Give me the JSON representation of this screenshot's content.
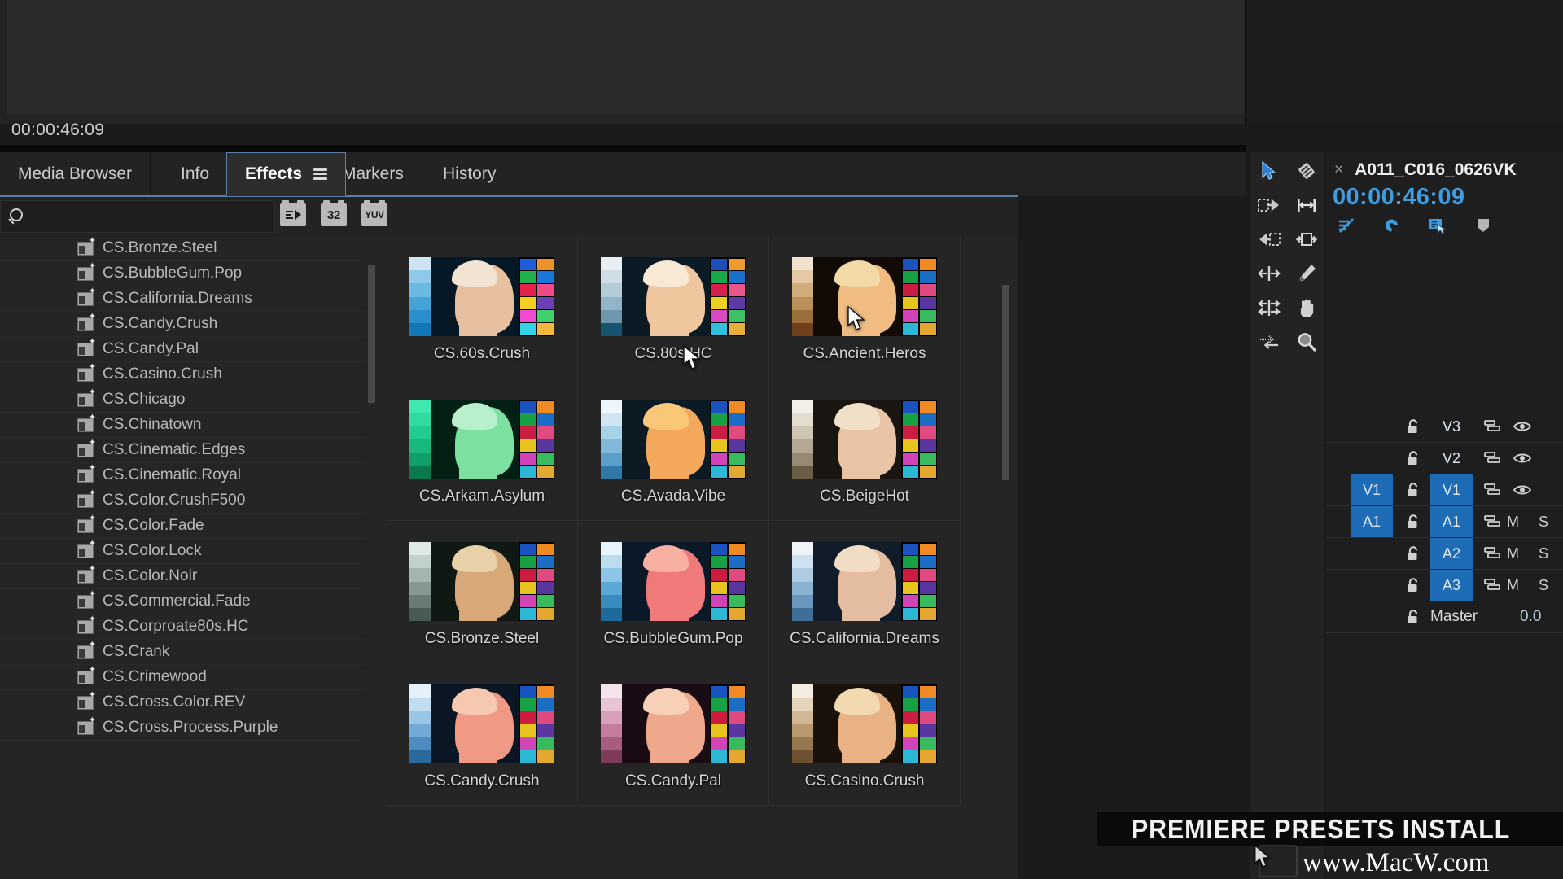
{
  "monitor": {
    "timecode": "00:00:46:09"
  },
  "tabs": [
    {
      "label": "Media Browser",
      "active": false,
      "menu": false
    },
    {
      "label": "Info",
      "active": false,
      "menu": false
    },
    {
      "label": "Effects",
      "active": true,
      "menu": true
    },
    {
      "label": "Markers",
      "active": false,
      "menu": false
    },
    {
      "label": "History",
      "active": false,
      "menu": false
    }
  ],
  "search": {
    "value": "",
    "placeholder": "",
    "icon": "search-icon",
    "badges": [
      {
        "name": "accelerated-effects-badge",
        "label": ""
      },
      {
        "name": "32-bit-color-badge",
        "label": "32"
      },
      {
        "name": "yuv-effects-badge",
        "label": "YUV"
      }
    ]
  },
  "effects_list": {
    "items": [
      "CS.Bronze.Steel",
      "CS.BubbleGum.Pop",
      "CS.California.Dreams",
      "CS.Candy.Crush",
      "CS.Candy.Pal",
      "CS.Casino.Crush",
      "CS.Chicago",
      "CS.Chinatown",
      "CS.Cinematic.Edges",
      "CS.Cinematic.Royal",
      "CS.Color.CrushF500",
      "CS.Color.Fade",
      "CS.Color.Lock",
      "CS.Color.Noir",
      "CS.Commercial.Fade",
      "CS.Corproate80s.HC",
      "CS.Crank",
      "CS.Crimewood",
      "CS.Cross.Color.REV",
      "CS.Cross.Process.Purple"
    ]
  },
  "grid": {
    "cells": [
      {
        "label": "CS.60s.Crush",
        "ramp": [
          "#cfe4f2",
          "#8ec9ea",
          "#6ab9e3",
          "#46a3d8",
          "#2a8fcc",
          "#1277b8"
        ],
        "bg": "#061726",
        "skin": "#e8c0a0",
        "hair": "#f2e4d2",
        "chips": [
          "#1d5fd8",
          "#f0922c",
          "#21b24c",
          "#1877d8",
          "#e8204a",
          "#ef4b86",
          "#f5d020",
          "#6b3fb5",
          "#f04bd0",
          "#3fd06a",
          "#34d4e8",
          "#f2b73c"
        ]
      },
      {
        "label": "CS.80s.HC",
        "ramp": [
          "#e8eef2",
          "#cfdde6",
          "#b4cbd8",
          "#93b4c6",
          "#6f98ae",
          "#14546f"
        ],
        "bg": "#0a1b26",
        "skin": "#f0c69e",
        "hair": "#f7e9d4",
        "chips": [
          "#1d4fb8",
          "#f09c2c",
          "#18a84a",
          "#1a72c8",
          "#d4204a",
          "#e8548c",
          "#ecd022",
          "#5e3aa8",
          "#d84bc0",
          "#3cc266",
          "#2fc0dc",
          "#e8b038"
        ]
      },
      {
        "label": "CS.Ancient.Heros",
        "ramp": [
          "#f2e3cf",
          "#e4c9a4",
          "#d2ad7c",
          "#bb8f58",
          "#9b6f3c",
          "#703f1c"
        ],
        "bg": "#120a04",
        "skin": "#f0bc82",
        "hair": "#f4d9a8",
        "chips": [
          "#1a52c0",
          "#f08a22",
          "#17a044",
          "#1a6fc4",
          "#cc1c42",
          "#e04a80",
          "#e8c41e",
          "#5a36a0",
          "#d044b8",
          "#38ba5e",
          "#2cb8d4",
          "#e4a830"
        ]
      },
      {
        "label": "CS.Arkam.Asylum",
        "ramp": [
          "#3fe8b0",
          "#2edba0",
          "#22cc90",
          "#19b97e",
          "#12a06a",
          "#0a7a4e"
        ],
        "bg": "#042014",
        "skin": "#7ce0a0",
        "hair": "#b8f0cc",
        "chips": [
          "#1a52c0",
          "#f08a22",
          "#17a044",
          "#1a6fc4",
          "#cc1c42",
          "#e04a80",
          "#e8c41e",
          "#5a36a0",
          "#d044b8",
          "#38ba5e",
          "#2cb8d4",
          "#e4a830"
        ]
      },
      {
        "label": "CS.Avada.Vibe",
        "ramp": [
          "#eef6fb",
          "#cfe6f2",
          "#a8d2e8",
          "#7fbadb",
          "#5a9fca",
          "#2f78a8"
        ],
        "bg": "#0c1a24",
        "skin": "#f4a85c",
        "hair": "#f8c878",
        "chips": [
          "#1a52c0",
          "#f08a22",
          "#17a044",
          "#1a6fc4",
          "#cc1c42",
          "#e04a80",
          "#e8c41e",
          "#5a36a0",
          "#d044b8",
          "#38ba5e",
          "#2cb8d4",
          "#e4a830"
        ]
      },
      {
        "label": "CS.BeigeHot",
        "ramp": [
          "#f4f0e8",
          "#e4ddd0",
          "#cfc5b4",
          "#b4a894",
          "#978a74",
          "#6a5d48"
        ],
        "bg": "#1a1510",
        "skin": "#e8c4a4",
        "hair": "#f0e0c8",
        "chips": [
          "#1a52c0",
          "#f08a22",
          "#17a044",
          "#1a6fc4",
          "#cc1c42",
          "#e04a80",
          "#e8c41e",
          "#5a36a0",
          "#d044b8",
          "#38ba5e",
          "#2cb8d4",
          "#e4a830"
        ]
      },
      {
        "label": "CS.Bronze.Steel",
        "ramp": [
          "#dfe8e4",
          "#c2d0cc",
          "#a4b4b0",
          "#879894",
          "#6a7a76",
          "#4a5a56"
        ],
        "bg": "#101814",
        "skin": "#d8a878",
        "hair": "#e8d0a8",
        "chips": [
          "#1a52c0",
          "#f08a22",
          "#17a044",
          "#1a6fc4",
          "#cc1c42",
          "#e04a80",
          "#e8c41e",
          "#5a36a0",
          "#d044b8",
          "#38ba5e",
          "#2cb8d4",
          "#e4a830"
        ]
      },
      {
        "label": "CS.BubbleGum.Pop",
        "ramp": [
          "#e8f4fb",
          "#bcdcf0",
          "#8cc4e4",
          "#5aa8d4",
          "#3a8cbf",
          "#1f6a9c"
        ],
        "bg": "#0a1828",
        "skin": "#f07a7a",
        "hair": "#f8b0a0",
        "chips": [
          "#1a52c0",
          "#f08a22",
          "#17a044",
          "#1a6fc4",
          "#cc1c42",
          "#e04a80",
          "#e8c41e",
          "#5a36a0",
          "#d044b8",
          "#38ba5e",
          "#2cb8d4",
          "#e4a830"
        ]
      },
      {
        "label": "CS.California.Dreams",
        "ramp": [
          "#eef4fa",
          "#cfe0ee",
          "#aecbe2",
          "#8cb2d2",
          "#6a96bc",
          "#3f6e96"
        ],
        "bg": "#101c2a",
        "skin": "#e4bca0",
        "hair": "#f0ddc4",
        "chips": [
          "#1a52c0",
          "#f08a22",
          "#17a044",
          "#1a6fc4",
          "#cc1c42",
          "#e04a80",
          "#e8c41e",
          "#5a36a0",
          "#d044b8",
          "#38ba5e",
          "#2cb8d4",
          "#e4a830"
        ]
      },
      {
        "label": "CS.Candy.Crush",
        "ramp": [
          "#e4f0fa",
          "#c0ddf0",
          "#9ac6e6",
          "#72aad6",
          "#4d8cc0",
          "#2a6a9c"
        ],
        "bg": "#0a1624",
        "skin": "#f09a86",
        "hair": "#f6c8b0",
        "chips": [
          "#1a52c0",
          "#f08a22",
          "#17a044",
          "#1a6fc4",
          "#cc1c42",
          "#e04a80",
          "#e8c41e",
          "#5a36a0",
          "#d044b8",
          "#38ba5e",
          "#2cb8d4",
          "#e4a830"
        ]
      },
      {
        "label": "CS.Candy.Pal",
        "ramp": [
          "#f4e4ec",
          "#e8c4d6",
          "#d8a0bc",
          "#c47c9e",
          "#a85c80",
          "#7e3c5a"
        ],
        "bg": "#1a0c14",
        "skin": "#f0a88c",
        "hair": "#f8d0b8",
        "chips": [
          "#1a52c0",
          "#f08a22",
          "#17a044",
          "#1a6fc4",
          "#cc1c42",
          "#e04a80",
          "#e8c41e",
          "#5a36a0",
          "#d044b8",
          "#38ba5e",
          "#2cb8d4",
          "#e4a830"
        ]
      },
      {
        "label": "CS.Casino.Crush",
        "ramp": [
          "#f4ece0",
          "#e4d4bc",
          "#d0b894",
          "#b8996e",
          "#96784f",
          "#6c5232"
        ],
        "bg": "#18120a",
        "skin": "#e8b284",
        "hair": "#f2d8ae",
        "chips": [
          "#1a52c0",
          "#f08a22",
          "#17a044",
          "#1a6fc4",
          "#cc1c42",
          "#e04a80",
          "#e8c41e",
          "#5a36a0",
          "#d044b8",
          "#38ba5e",
          "#2cb8d4",
          "#e4a830"
        ]
      }
    ]
  },
  "tools": [
    {
      "name": "selection-tool",
      "active": true
    },
    {
      "name": "razor-tool",
      "active": false
    },
    {
      "name": "track-select-forward-tool",
      "active": false
    },
    {
      "name": "ripple-edit-tool",
      "active": false
    },
    {
      "name": "track-select-backward-tool",
      "active": false
    },
    {
      "name": "rolling-edit-tool",
      "active": false
    },
    {
      "name": "rate-stretch-tool",
      "active": false
    },
    {
      "name": "pen-tool",
      "active": false
    },
    {
      "name": "slip-tool",
      "active": false
    },
    {
      "name": "hand-tool",
      "active": false
    },
    {
      "name": "slide-tool",
      "active": false
    },
    {
      "name": "zoom-tool",
      "active": false
    }
  ],
  "timeline": {
    "sequence_name": "A011_C016_0626VK",
    "close_label": "×",
    "timecode": "00:00:46:09",
    "toggles": [
      {
        "name": "insert-overwrite-source-patching-icon",
        "active": true
      },
      {
        "name": "snap-magnet-icon",
        "active": true
      },
      {
        "name": "linked-selection-icon",
        "active": true
      },
      {
        "name": "add-marker-icon",
        "active": false
      }
    ],
    "tracks": [
      {
        "name": "V3",
        "type": "video",
        "source": "",
        "source_on": false,
        "target_on": false,
        "eye": true,
        "mute": "",
        "solo": ""
      },
      {
        "name": "V2",
        "type": "video",
        "source": "",
        "source_on": false,
        "target_on": false,
        "eye": true,
        "mute": "",
        "solo": ""
      },
      {
        "name": "V1",
        "type": "video",
        "source": "V1",
        "source_on": true,
        "target_on": true,
        "eye": true,
        "mute": "",
        "solo": ""
      },
      {
        "name": "A1",
        "type": "audio",
        "source": "A1",
        "source_on": true,
        "target_on": true,
        "eye": false,
        "mute": "M",
        "solo": "S"
      },
      {
        "name": "A2",
        "type": "audio",
        "source": "",
        "source_on": false,
        "target_on": true,
        "eye": false,
        "mute": "M",
        "solo": "S"
      },
      {
        "name": "A3",
        "type": "audio",
        "source": "",
        "source_on": false,
        "target_on": true,
        "eye": false,
        "mute": "M",
        "solo": "S"
      },
      {
        "name": "Master",
        "type": "master",
        "source": "",
        "source_on": false,
        "target_on": false,
        "eye": false,
        "mute": "",
        "solo": "",
        "value": "0.0"
      }
    ]
  },
  "watermark": {
    "title": "PREMIERE PRESETS INSTALL",
    "url": "www.MacW.com"
  },
  "colors": {
    "accent_blue": "#1d6cb5",
    "timecode_blue": "#3d9de0",
    "tab_outline": "#5b7fa6",
    "panel_bg": "#232323"
  }
}
